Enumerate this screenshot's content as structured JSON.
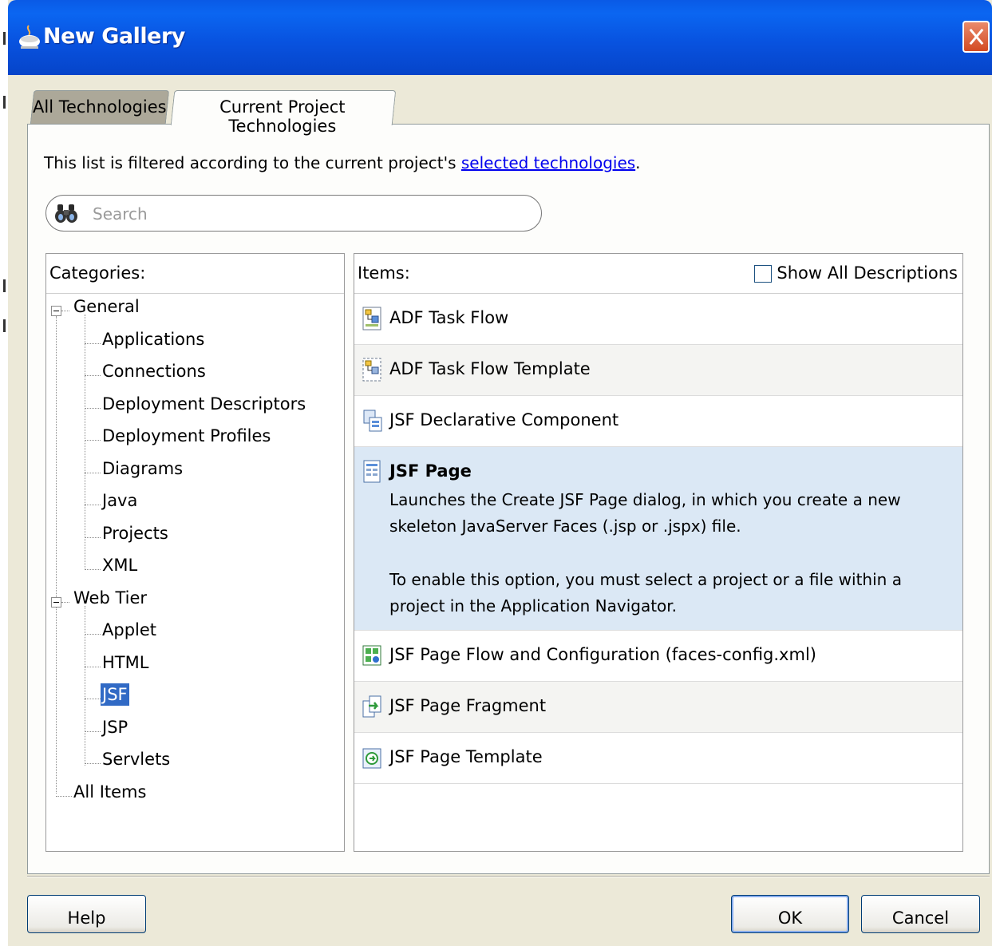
{
  "window": {
    "title": "New Gallery"
  },
  "tabs": [
    {
      "label": "All Technologies",
      "active": false
    },
    {
      "label": "Current Project Technologies",
      "active": true
    }
  ],
  "filter": {
    "prefix": "This list is filtered according to the current project's ",
    "link": "selected technologies",
    "suffix": "."
  },
  "search": {
    "placeholder": "Search",
    "value": ""
  },
  "categories": {
    "header": "Categories:",
    "tree": [
      {
        "label": "General",
        "level": 0,
        "expanded": true
      },
      {
        "label": "Applications",
        "level": 1
      },
      {
        "label": "Connections",
        "level": 1
      },
      {
        "label": "Deployment Descriptors",
        "level": 1
      },
      {
        "label": "Deployment Profiles",
        "level": 1
      },
      {
        "label": "Diagrams",
        "level": 1
      },
      {
        "label": "Java",
        "level": 1
      },
      {
        "label": "Projects",
        "level": 1
      },
      {
        "label": "XML",
        "level": 1
      },
      {
        "label": "Web Tier",
        "level": 0,
        "expanded": true
      },
      {
        "label": "Applet",
        "level": 1
      },
      {
        "label": "HTML",
        "level": 1
      },
      {
        "label": "JSF",
        "level": 1,
        "selected": true
      },
      {
        "label": "JSP",
        "level": 1
      },
      {
        "label": "Servlets",
        "level": 1
      },
      {
        "label": "All Items",
        "level": 0
      }
    ]
  },
  "items": {
    "header": "Items:",
    "show_all_label": "Show All Descriptions",
    "show_all_checked": false,
    "list": [
      {
        "label": "ADF Task Flow",
        "icon": "task-flow-icon"
      },
      {
        "label": "ADF Task Flow Template",
        "icon": "task-flow-template-icon"
      },
      {
        "label": "JSF Declarative Component",
        "icon": "declarative-component-icon"
      },
      {
        "label": "JSF Page",
        "icon": "jsf-page-icon",
        "selected": true,
        "desc1": "Launches the Create JSF Page dialog, in which you create a new skeleton JavaServer Faces (.jsp or .jspx) file.",
        "desc2": "To enable this option, you must select a project or a file within a project in the Application Navigator."
      },
      {
        "label": "JSF Page Flow and Configuration (faces-config.xml)",
        "icon": "page-flow-config-icon"
      },
      {
        "label": "JSF Page Fragment",
        "icon": "page-fragment-icon"
      },
      {
        "label": "JSF Page Template",
        "icon": "page-template-icon"
      }
    ]
  },
  "buttons": {
    "help": "Help",
    "ok": "OK",
    "cancel": "Cancel"
  },
  "colors": {
    "titlebar": "#0853e0",
    "selection": "#316ac5",
    "selected_item_bg": "#dbe8f5"
  }
}
